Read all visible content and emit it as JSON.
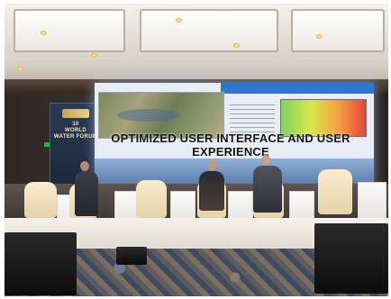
{
  "photo": {
    "description_id": "panel-session-stage",
    "banner": {
      "line1": "10",
      "line2": "WORLD",
      "line3": "WATER FORUM"
    },
    "screen": {
      "caption": "OPTIMIZED USER INTERFACE AND USER EXPERIENCE"
    }
  }
}
